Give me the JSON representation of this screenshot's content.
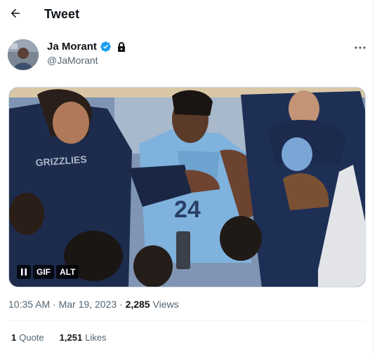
{
  "header": {
    "title": "Tweet",
    "back_icon": "arrow-left-icon"
  },
  "author": {
    "name": "Ja Morant",
    "handle": "@JaMorant",
    "verified_color": "#1d9bf0",
    "icons": [
      "verified-badge-icon",
      "lock-icon",
      "more-horizontal-icon"
    ]
  },
  "media": {
    "type": "GIF",
    "badges": {
      "pause_icon": "pause-icon",
      "gif_label": "GIF",
      "alt_label": "ALT"
    },
    "jersey_text": "GRIZZLIES"
  },
  "meta": {
    "time": "10:35 AM",
    "date": "Mar 19, 2023",
    "separator": "·",
    "views_count": "2,285",
    "views_label": "Views"
  },
  "stats": {
    "quotes_count": "1",
    "quotes_label": "Quote",
    "likes_count": "1,251",
    "likes_label": "Likes"
  },
  "colors": {
    "text_primary": "#0f1419",
    "text_secondary": "#536471",
    "divider": "#eff3f4"
  }
}
